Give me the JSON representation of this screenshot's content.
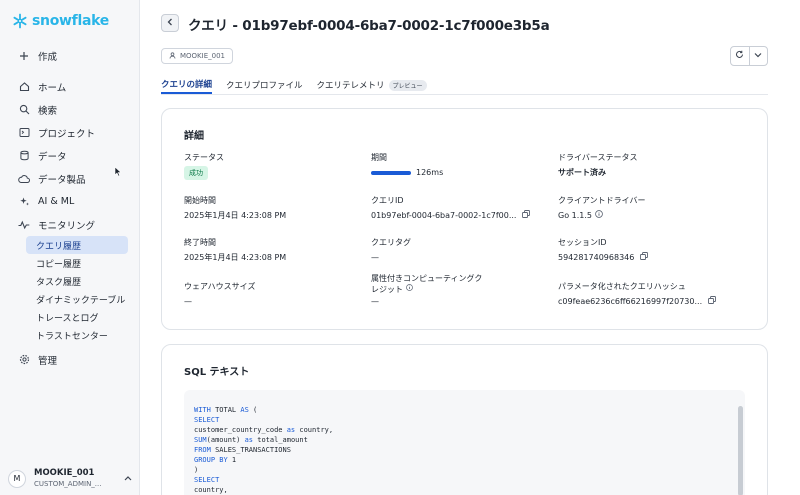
{
  "app": {
    "logo_text": "snowflake",
    "brand_color": "#29b5e8",
    "accent_color": "#1a5bd6"
  },
  "sidebar": {
    "create": {
      "label": "作成",
      "icon": "plus-icon"
    },
    "items": [
      {
        "label": "ホーム",
        "icon": "home-icon"
      },
      {
        "label": "検索",
        "icon": "search-icon"
      },
      {
        "label": "プロジェクト",
        "icon": "terminal-icon"
      },
      {
        "label": "データ",
        "icon": "database-icon"
      },
      {
        "label": "データ製品",
        "icon": "cloud-icon"
      },
      {
        "label": "AI & ML",
        "icon": "sparkle-icon"
      },
      {
        "label": "モニタリング",
        "icon": "activity-icon"
      }
    ],
    "monitoring_sub": [
      {
        "label": "クエリ履歴",
        "active": true
      },
      {
        "label": "コピー履歴"
      },
      {
        "label": "タスク履歴"
      },
      {
        "label": "ダイナミックテーブル"
      },
      {
        "label": "トレースとログ"
      },
      {
        "label": "トラストセンター"
      }
    ],
    "admin": {
      "label": "管理",
      "icon": "gear-icon"
    },
    "user": {
      "initial": "M",
      "name": "MOOKIE_001",
      "role": "CUSTOM_ADMIN_..."
    }
  },
  "header": {
    "title": "クエリ - 01b97ebf-0004-6ba7-0002-1c7f000e3b5a",
    "user_chip": "MOOKIE_001"
  },
  "tabs": [
    {
      "label": "クエリの詳細",
      "active": true
    },
    {
      "label": "クエリプロファイル"
    },
    {
      "label": "クエリテレメトリ",
      "badge": "プレビュー"
    }
  ],
  "details": {
    "title": "詳細",
    "status": {
      "label": "ステータス",
      "value": "成功"
    },
    "duration": {
      "label": "期間",
      "value": "126ms",
      "bar_fraction": 1.0
    },
    "driver_status": {
      "label": "ドライバーステータス",
      "value": "サポート済み"
    },
    "start_time": {
      "label": "開始時間",
      "value": "2025年1月4日 4:23:08 PM"
    },
    "query_id": {
      "label": "クエリID",
      "value": "01b97ebf-0004-6ba7-0002-1c7f00..."
    },
    "client_driver": {
      "label": "クライアントドライバー",
      "value": "Go 1.1.5"
    },
    "end_time": {
      "label": "終了時間",
      "value": "2025年1月4日 4:23:08 PM"
    },
    "query_tag": {
      "label": "クエリタグ",
      "value": "—"
    },
    "session_id": {
      "label": "セッションID",
      "value": "594281740968346"
    },
    "warehouse_size": {
      "label": "ウェアハウスサイズ",
      "value": "—"
    },
    "credits": {
      "label_line1": "属性付きコンピューティングク",
      "label_line2": "レジット",
      "value": "—"
    },
    "param_hash": {
      "label": "パラメータ化されたクエリハッシュ",
      "value": "c09feae6236c6ff66216997f20730..."
    }
  },
  "sql": {
    "title": "SQL テキスト",
    "lines": [
      {
        "kw": "WITH",
        "rest": " TOTAL ",
        "kw2": "AS",
        "rest2": " ("
      },
      {
        "kw": "SELECT",
        "rest": "",
        "kw2": "",
        "rest2": ""
      },
      {
        "kw": "",
        "rest": "customer_country_code ",
        "kw2": "as",
        "rest2": " country,"
      },
      {
        "kw": "SUM",
        "rest": "(amount) ",
        "kw2": "as",
        "rest2": " total_amount"
      },
      {
        "kw": "FROM",
        "rest": " SALES_TRANSACTIONS",
        "kw2": "",
        "rest2": ""
      },
      {
        "kw": "GROUP BY",
        "rest": " 1",
        "kw2": "",
        "rest2": ""
      },
      {
        "kw": "",
        "rest": ")",
        "kw2": "",
        "rest2": ""
      },
      {
        "kw": "SELECT",
        "rest": "",
        "kw2": "",
        "rest2": ""
      },
      {
        "kw": "",
        "rest": "country,",
        "kw2": "",
        "rest2": ""
      }
    ]
  }
}
